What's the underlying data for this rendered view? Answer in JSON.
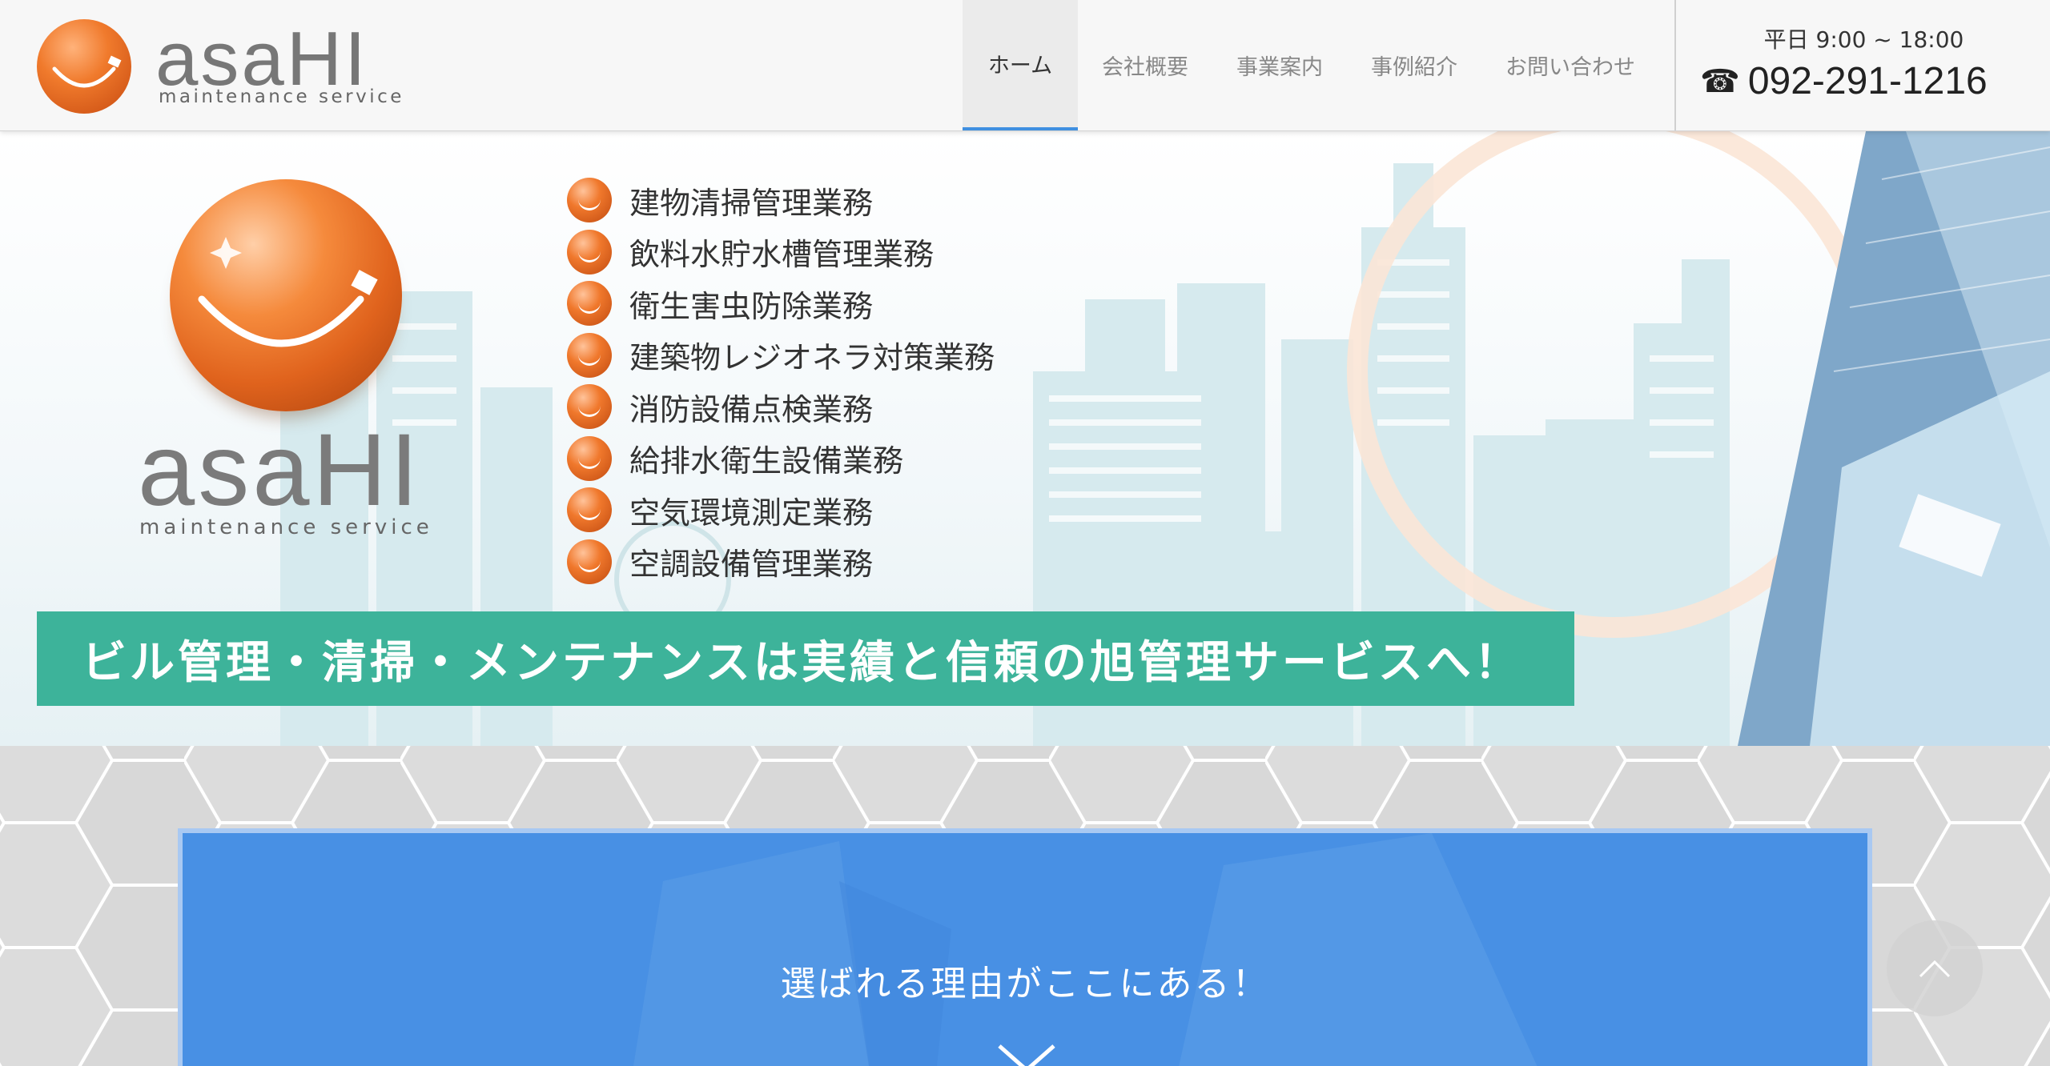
{
  "header": {
    "logo": {
      "word": "asaHI",
      "sub": "maintenance service"
    },
    "nav": [
      {
        "label": "ホーム",
        "active": true
      },
      {
        "label": "会社概要"
      },
      {
        "label": "事業案内"
      },
      {
        "label": "事例紹介"
      },
      {
        "label": "お問い合わせ"
      }
    ],
    "contact": {
      "hours": "平日 9:00 ~ 18:00",
      "phone": "092-291-1216",
      "icon": "phone-icon"
    }
  },
  "hero": {
    "logo": {
      "word": "asaHI",
      "sub": "maintenance service"
    },
    "services": [
      "建物清掃管理業務",
      "飲料水貯水槽管理業務",
      "衛生害虫防除業務",
      "建築物レジオネラ対策業務",
      "消防設備点検業務",
      "給排水衛生設備業務",
      "空気環境測定業務",
      "空調設備管理業務"
    ],
    "banner": "ビル管理・清掃・メンテナンスは実績と信頼の旭管理サービスへ！"
  },
  "reason": {
    "title": "選ばれる理由がここにある！",
    "icon": "chevron-down-icon"
  },
  "scroll_top": {
    "icon": "chevron-up-icon"
  },
  "colors": {
    "accent": "#3f8fe0",
    "banner": "#3db39a",
    "card": "#4890e4",
    "orange": "#f07a2c"
  }
}
